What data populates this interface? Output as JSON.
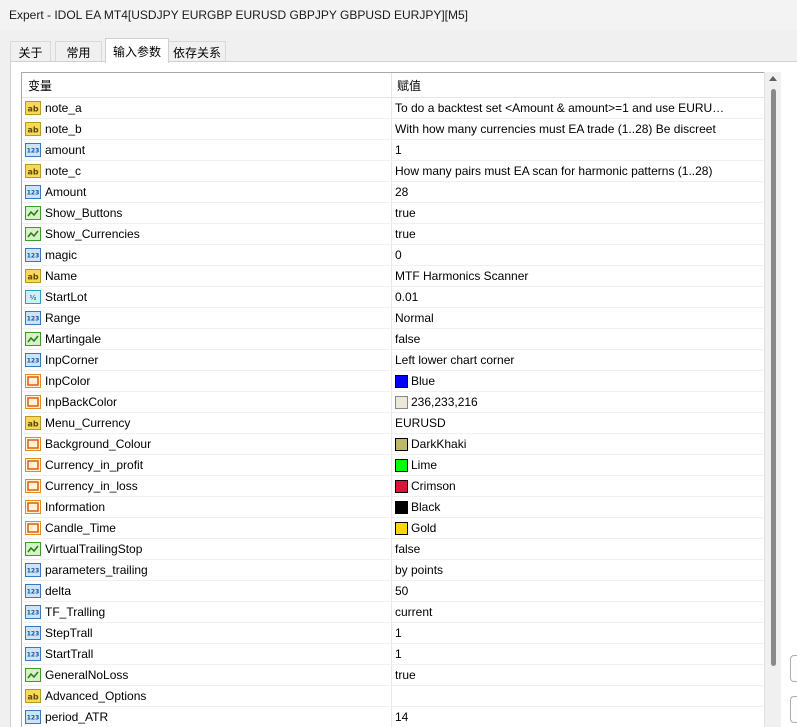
{
  "window": {
    "title": "Expert - IDOL EA MT4[USDJPY EURGBP EURUSD GBPJPY GBPUSD EURJPY][M5]"
  },
  "tabs": [
    {
      "label": "关于"
    },
    {
      "label": "常用"
    },
    {
      "label": "输入参数"
    },
    {
      "label": "依存关系"
    }
  ],
  "grid": {
    "col_variable": "变量",
    "col_value": "赋值",
    "rows": [
      {
        "type": "string",
        "name": "note_a",
        "value": "To do a backtest set <Amount & amount>=1 and use EURU…"
      },
      {
        "type": "string",
        "name": "note_b",
        "value": "With how many currencies must EA trade (1..28) Be discreet"
      },
      {
        "type": "int",
        "name": "amount",
        "value": "1"
      },
      {
        "type": "string",
        "name": "note_c",
        "value": "How many pairs must EA scan for harmonic patterns (1..28)"
      },
      {
        "type": "int",
        "name": "Amount",
        "value": "28"
      },
      {
        "type": "bool",
        "name": "Show_Buttons",
        "value": "true"
      },
      {
        "type": "bool",
        "name": "Show_Currencies",
        "value": "true"
      },
      {
        "type": "int",
        "name": "magic",
        "value": "0"
      },
      {
        "type": "string",
        "name": "Name",
        "value": "MTF Harmonics Scanner"
      },
      {
        "type": "double",
        "name": "StartLot",
        "value": "0.01"
      },
      {
        "type": "int",
        "name": "Range",
        "value": "Normal"
      },
      {
        "type": "bool",
        "name": "Martingale",
        "value": "false"
      },
      {
        "type": "int",
        "name": "InpCorner",
        "value": "Left lower chart corner"
      },
      {
        "type": "color",
        "name": "InpColor",
        "value": "Blue",
        "swatch": "#0000ff"
      },
      {
        "type": "color",
        "name": "InpBackColor",
        "value": "236,233,216",
        "swatch": "#ece9d8"
      },
      {
        "type": "string",
        "name": "Menu_Currency",
        "value": "EURUSD"
      },
      {
        "type": "color",
        "name": "Background_Colour",
        "value": "DarkKhaki",
        "swatch": "#bdb76b"
      },
      {
        "type": "color",
        "name": "Currency_in_profit",
        "value": "Lime",
        "swatch": "#00ff00"
      },
      {
        "type": "color",
        "name": "Currency_in_loss",
        "value": "Crimson",
        "swatch": "#dc143c"
      },
      {
        "type": "color",
        "name": "Information",
        "value": "Black",
        "swatch": "#000000"
      },
      {
        "type": "color",
        "name": "Candle_Time",
        "value": "Gold",
        "swatch": "#ffd700"
      },
      {
        "type": "bool",
        "name": "VirtualTrailingStop",
        "value": "false"
      },
      {
        "type": "int",
        "name": "parameters_trailing",
        "value": "by points"
      },
      {
        "type": "int",
        "name": "delta",
        "value": "50"
      },
      {
        "type": "int",
        "name": "TF_Tralling",
        "value": "current"
      },
      {
        "type": "int",
        "name": "StepTrall",
        "value": "1"
      },
      {
        "type": "int",
        "name": "StartTrall",
        "value": "1"
      },
      {
        "type": "bool",
        "name": "GeneralNoLoss",
        "value": "true"
      },
      {
        "type": "string",
        "name": "Advanced_Options",
        "value": ""
      },
      {
        "type": "int",
        "name": "period_ATR",
        "value": "14"
      }
    ]
  },
  "icon_names": {
    "string": "string-type-icon",
    "int": "integer-type-icon",
    "bool": "boolean-type-icon",
    "double": "double-type-icon",
    "color": "color-type-icon"
  }
}
